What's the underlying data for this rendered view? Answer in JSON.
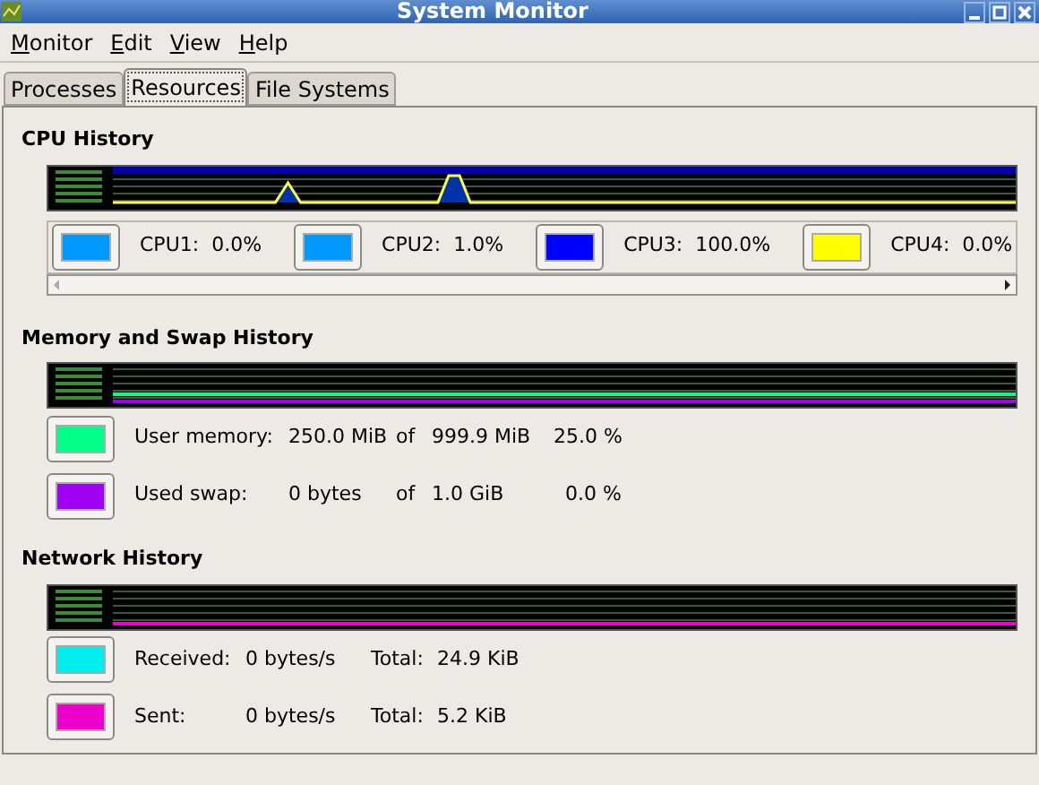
{
  "window": {
    "title": "System Monitor"
  },
  "menu": [
    {
      "key": "M",
      "rest": "onitor"
    },
    {
      "key": "E",
      "rest": "dit"
    },
    {
      "key": "V",
      "rest": "iew"
    },
    {
      "key": "H",
      "rest": "elp"
    }
  ],
  "tabs": [
    {
      "label": "Processes",
      "selected": false
    },
    {
      "label": "Resources",
      "selected": true
    },
    {
      "label": "File Systems",
      "selected": false
    }
  ],
  "cpu": {
    "title": "CPU History",
    "cpus": [
      {
        "label": "CPU1:",
        "value": "0.0%",
        "color": "#0099ff"
      },
      {
        "label": "CPU2:",
        "value": "1.0%",
        "color": "#0099ff"
      },
      {
        "label": "CPU3:",
        "value": "100.0%",
        "color": "#0000ff"
      },
      {
        "label": "CPU4:",
        "value": "0.0%",
        "color": "#ffff00"
      }
    ]
  },
  "memory": {
    "title": "Memory and Swap History",
    "rows": [
      {
        "label": "User memory:",
        "used": "250.0 MiB",
        "of": "of",
        "total": "999.9 MiB",
        "percent": "25.0 %",
        "color": "#00ff88"
      },
      {
        "label": "Used swap:",
        "used": "0 bytes",
        "of": "of",
        "total": "1.0 GiB",
        "percent": "0.0 %",
        "color": "#a000f0"
      }
    ]
  },
  "network": {
    "title": "Network History",
    "rows": [
      {
        "label": "Received:",
        "rate": "0 bytes/s",
        "total_label": "Total:",
        "total": "24.9 KiB",
        "color": "#00eeee"
      },
      {
        "label": "Sent:",
        "rate": "0 bytes/s",
        "total_label": "Total:",
        "total": "5.2 KiB",
        "color": "#ee00cc"
      }
    ]
  }
}
